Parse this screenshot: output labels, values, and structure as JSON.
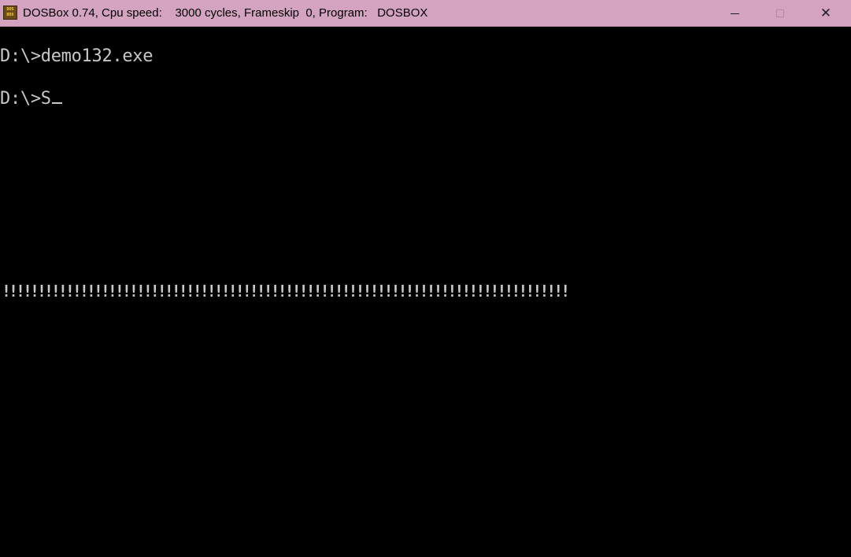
{
  "window": {
    "title": "DOSBox 0.74, Cpu speed:    3000 cycles, Frameskip  0, Program:   DOSBOX",
    "icon": "dosbox-icon",
    "icon_text_top": "DOS",
    "icon_text_bottom": "BOX",
    "controls": {
      "minimize": "minimize-icon",
      "maximize": "maximize-icon",
      "close": "close-icon",
      "close_glyph": "✕"
    },
    "colors": {
      "titlebar": "#d4a3c0",
      "console_bg": "#000000",
      "console_text": "#c8c8c8"
    }
  },
  "console": {
    "lines": [
      "D:\\>demo132.exe",
      "D:\\>S"
    ],
    "cursor": "_",
    "output_row": "!!!!!!!!!!!!!!!!!!!!!!!!!!!!!!!!!!!!!!!!!!!!!!!!!!!!!!!!!!!!!!!!!!!!!!!!!!!!!!!!"
  }
}
